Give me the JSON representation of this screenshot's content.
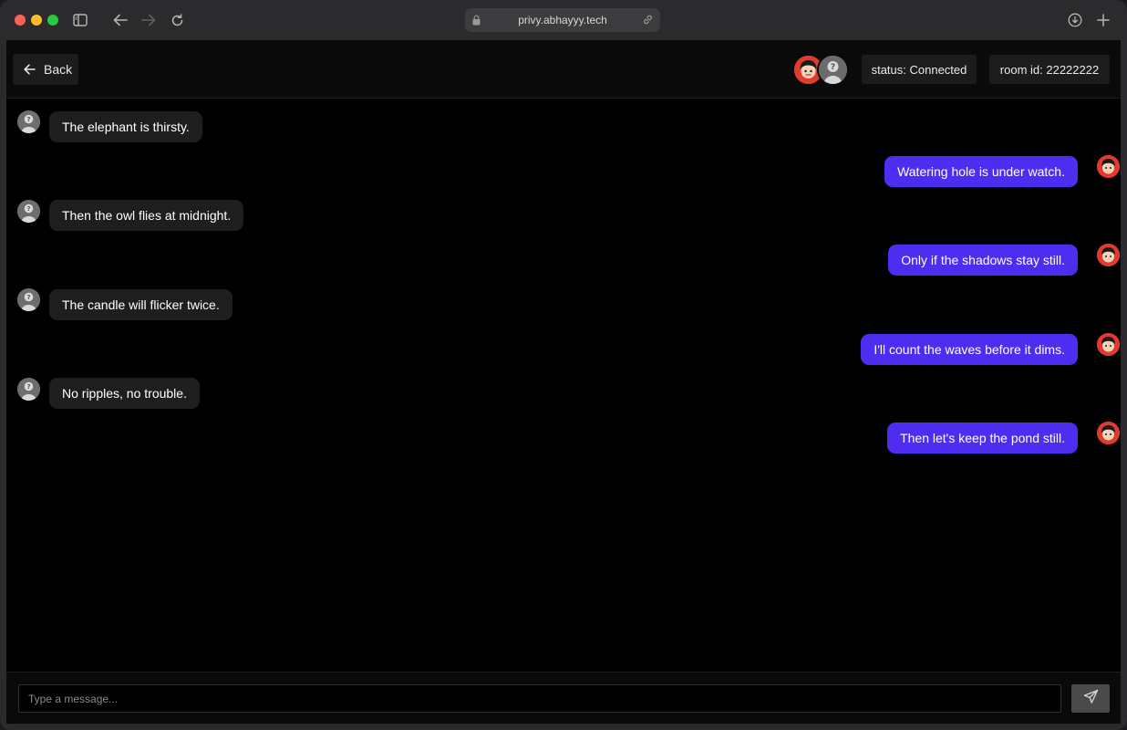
{
  "browser": {
    "url": "privy.abhayyy.tech",
    "icons": [
      "sidebar-icon",
      "back-icon",
      "forward-icon",
      "reload-icon",
      "lock-icon",
      "link-icon",
      "download-icon",
      "new-tab-icon"
    ]
  },
  "header": {
    "back_label": "Back",
    "status_text": "status: Connected",
    "room_text": "room id: 22222222"
  },
  "messages": [
    {
      "side": "in",
      "text": "The elephant is thirsty."
    },
    {
      "side": "out",
      "text": "Watering hole is under watch."
    },
    {
      "side": "in",
      "text": "Then the owl flies at midnight."
    },
    {
      "side": "out",
      "text": "Only if the shadows stay still."
    },
    {
      "side": "in",
      "text": "The candle will flicker twice."
    },
    {
      "side": "out",
      "text": "I'll count the waves before it dims."
    },
    {
      "side": "in",
      "text": "No ripples, no trouble."
    },
    {
      "side": "out",
      "text": "Then let's keep the pond still."
    }
  ],
  "composer": {
    "placeholder": "Type a message..."
  },
  "colors": {
    "outgoing_bubble": "#4f2df0",
    "incoming_bubble": "#1e1e1e",
    "background": "#000000"
  }
}
